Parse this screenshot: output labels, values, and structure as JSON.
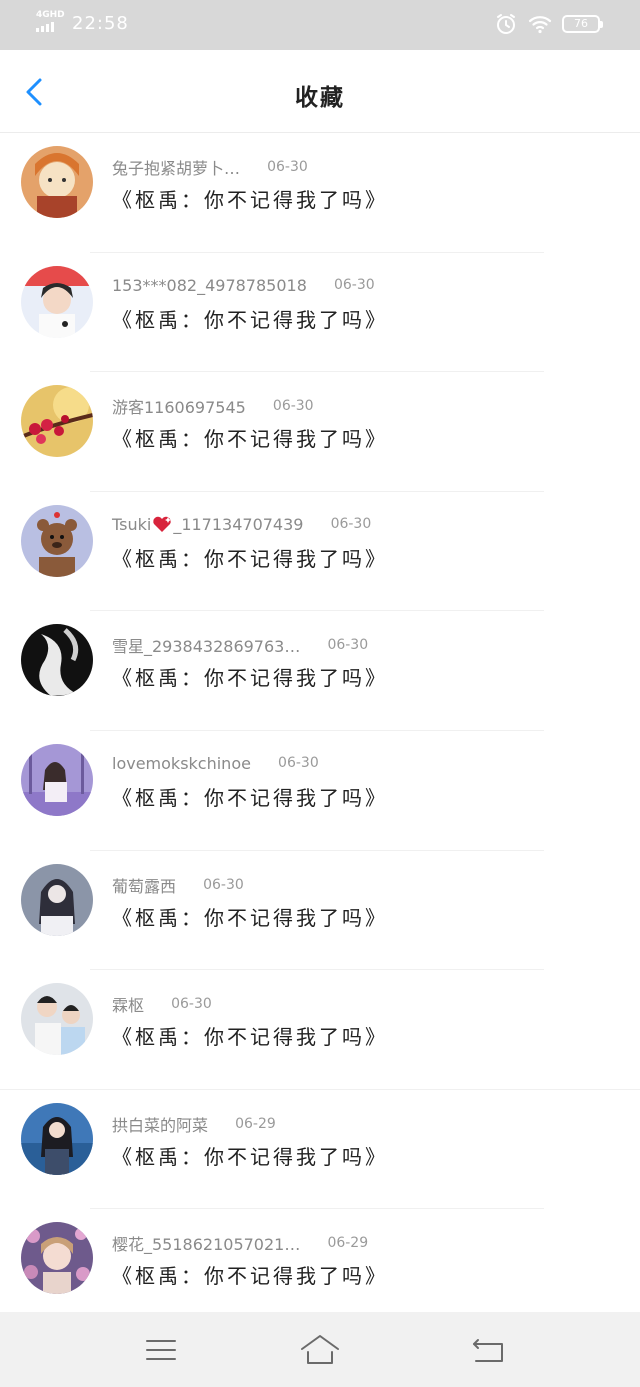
{
  "status_bar": {
    "network": "4GHD",
    "time": "22:58",
    "battery": "76",
    "icons": [
      "signal-icon",
      "alarm-icon",
      "wifi-icon",
      "battery-icon"
    ]
  },
  "header": {
    "title": "收藏",
    "back_icon": "chevron-left-icon",
    "accent_color": "#1e90ff"
  },
  "items": [
    {
      "nickname": "兔子抱紧胡萝卜…",
      "date": "06-30",
      "title": "《枢禹：你不记得我了吗》"
    },
    {
      "nickname": "153***082_4978785018",
      "date": "06-30",
      "title": "《枢禹：你不记得我了吗》"
    },
    {
      "nickname": "游客1160697545",
      "date": "06-30",
      "title": "《枢禹：你不记得我了吗》"
    },
    {
      "nickname": "Tsuki",
      "nickname_suffix": "_117134707439",
      "date": "06-30",
      "title": "《枢禹：你不记得我了吗》",
      "emoji": "sparkling-heart-icon"
    },
    {
      "nickname": "雪星_2938432869763…",
      "date": "06-30",
      "title": "《枢禹：你不记得我了吗》"
    },
    {
      "nickname": "lovemokskchinoe",
      "date": "06-30",
      "title": "《枢禹：你不记得我了吗》"
    },
    {
      "nickname": "葡萄露西",
      "date": "06-30",
      "title": "《枢禹：你不记得我了吗》"
    },
    {
      "nickname": "霖枢",
      "date": "06-30",
      "title": "《枢禹：你不记得我了吗》"
    },
    {
      "nickname": "拱白菜的阿菜",
      "date": "06-29",
      "title": "《枢禹：你不记得我了吗》"
    },
    {
      "nickname": "樱花_5518621057021…",
      "date": "06-29",
      "title": "《枢禹：你不记得我了吗》"
    }
  ],
  "nav_bar": {
    "icons": [
      "menu-icon",
      "home-icon",
      "back-icon"
    ]
  }
}
